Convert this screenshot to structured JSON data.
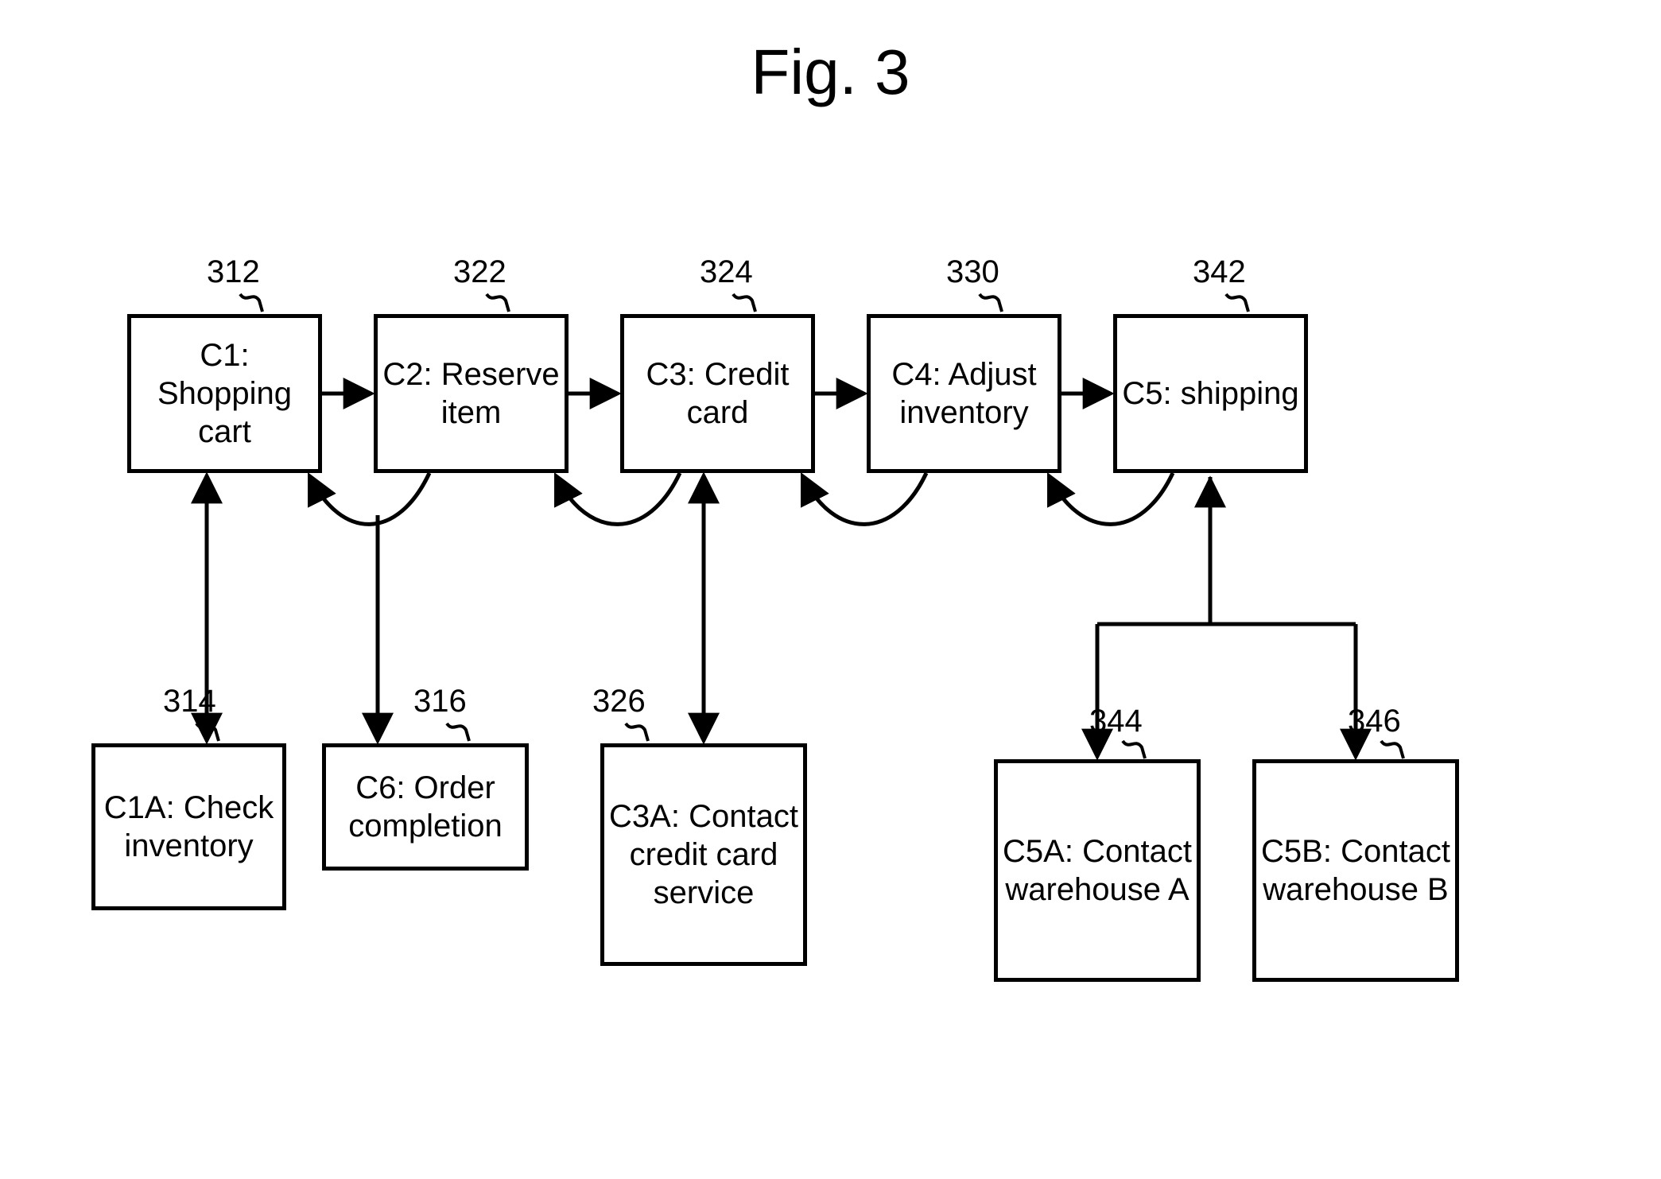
{
  "title": "Fig. 3",
  "nodes": {
    "c1": {
      "ref": "312",
      "label": "C1: Shopping cart"
    },
    "c2": {
      "ref": "322",
      "label": "C2: Reserve item"
    },
    "c3": {
      "ref": "324",
      "label": "C3: Credit card"
    },
    "c4": {
      "ref": "330",
      "label": "C4: Adjust inventory"
    },
    "c5": {
      "ref": "342",
      "label": "C5: shipping"
    },
    "c1a": {
      "ref": "314",
      "label": "C1A: Check inventory"
    },
    "c6": {
      "ref": "316",
      "label": "C6: Order completion"
    },
    "c3a": {
      "ref": "326",
      "label": "C3A: Contact credit card service"
    },
    "c5a": {
      "ref": "344",
      "label": "C5A: Contact warehouse A"
    },
    "c5b": {
      "ref": "346",
      "label": "C5B: Contact warehouse B"
    }
  }
}
